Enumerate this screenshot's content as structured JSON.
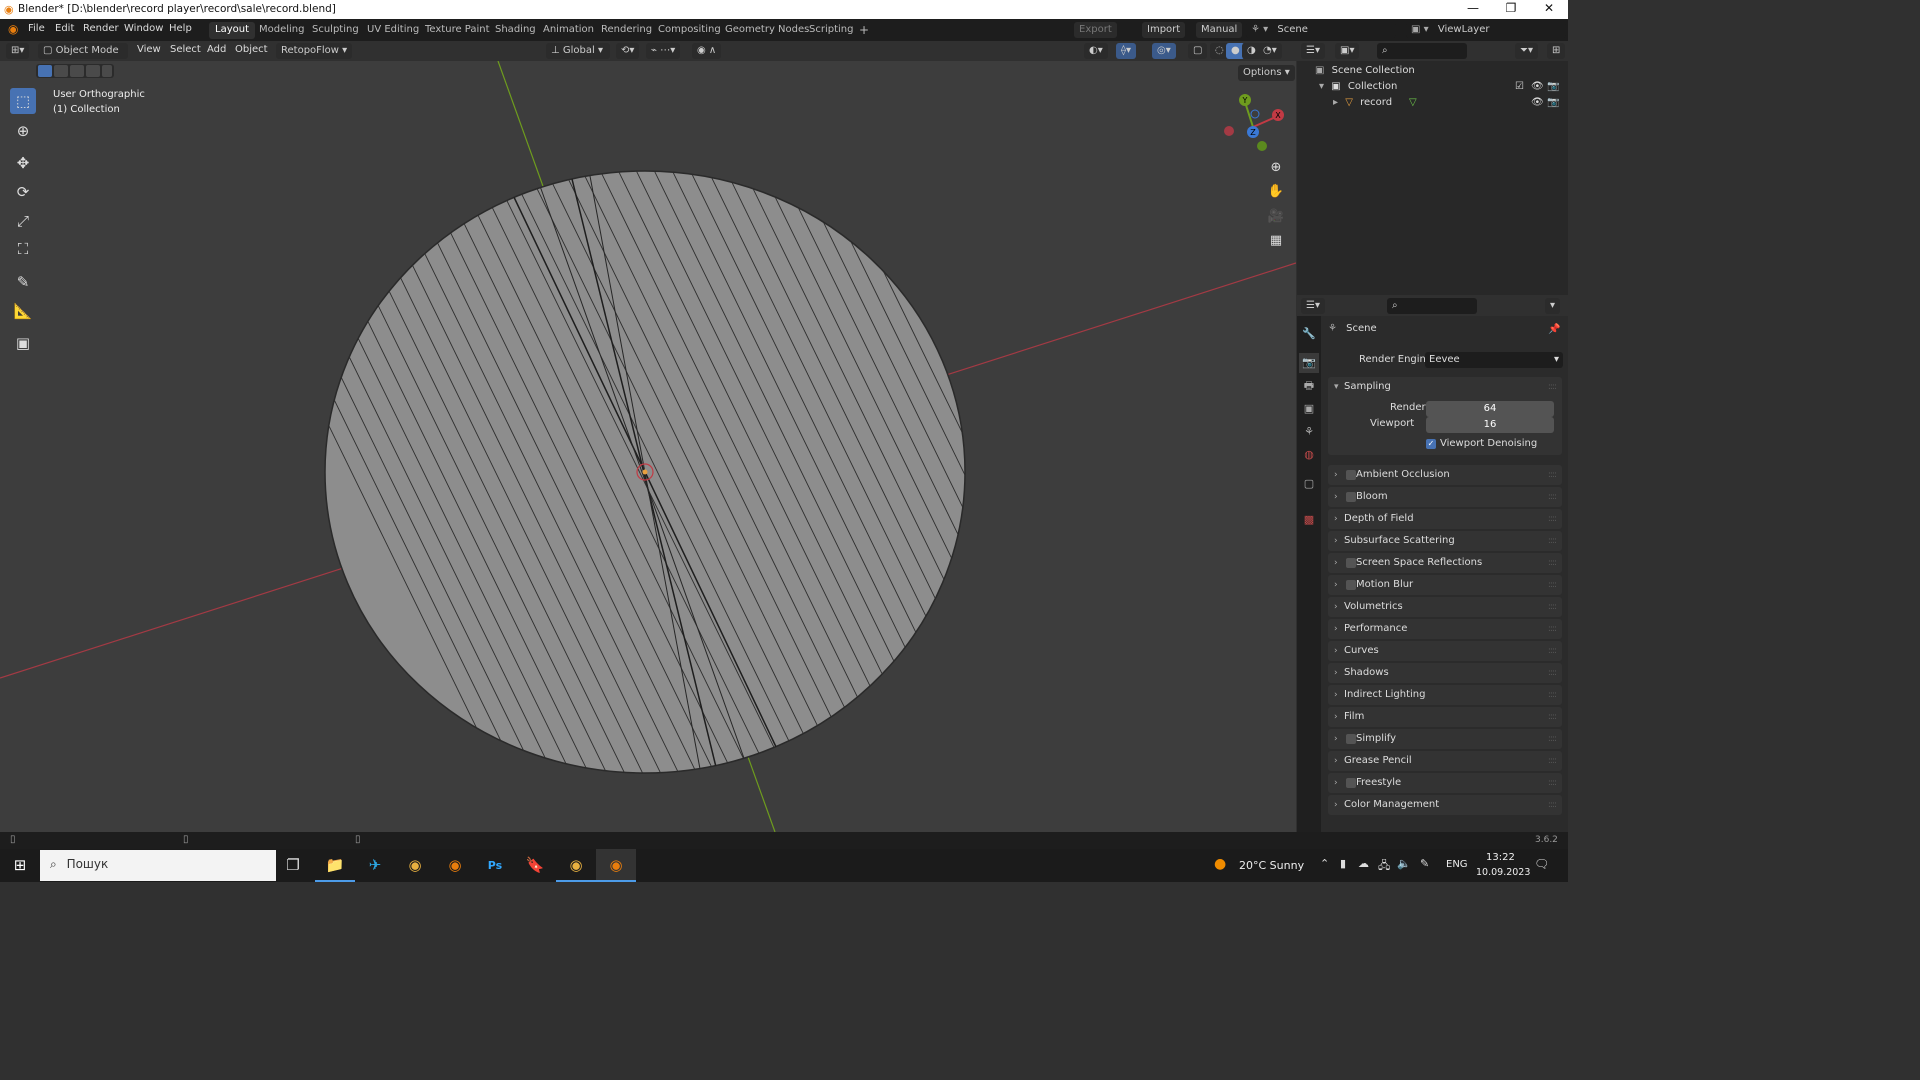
{
  "window": {
    "title": "Blender* [D:\\blender\\record player\\record\\sale\\record.blend]"
  },
  "menu": {
    "file": "File",
    "edit": "Edit",
    "render": "Render",
    "window": "Window",
    "help": "Help"
  },
  "workspaces": [
    "Layout",
    "Modeling",
    "Sculpting",
    "UV Editing",
    "Texture Paint",
    "Shading",
    "Animation",
    "Rendering",
    "Compositing",
    "Geometry Nodes",
    "Scripting"
  ],
  "add_workspace": "+",
  "top_right": {
    "export": "Export",
    "import": "Import",
    "manual": "Manual",
    "scene": "Scene",
    "view_layer": "ViewLayer"
  },
  "viewport_header": {
    "mode": "Object Mode",
    "view": "View",
    "select": "Select",
    "add": "Add",
    "object": "Object",
    "addon": "RetopoFlow",
    "transform_orientation": "Global",
    "options": "Options"
  },
  "viewport": {
    "view_name": "User Orthographic",
    "collection": "(1) Collection"
  },
  "gizmo": {
    "x": "X",
    "y": "Y",
    "z": "Z"
  },
  "outliner": {
    "scene_collection": "Scene Collection",
    "collection": "Collection",
    "object": "record"
  },
  "properties": {
    "scene_label": "Scene",
    "render_engine_label": "Render Engine",
    "render_engine_value": "Eevee",
    "sampling": {
      "title": "Sampling",
      "render_label": "Render",
      "render_value": "64",
      "viewport_label": "Viewport",
      "viewport_value": "16",
      "denoise_label": "Viewport Denoising"
    },
    "panels": [
      {
        "label": "Ambient Occlusion",
        "checkbox": true
      },
      {
        "label": "Bloom",
        "checkbox": true
      },
      {
        "label": "Depth of Field",
        "checkbox": false
      },
      {
        "label": "Subsurface Scattering",
        "checkbox": false
      },
      {
        "label": "Screen Space Reflections",
        "checkbox": true
      },
      {
        "label": "Motion Blur",
        "checkbox": true
      },
      {
        "label": "Volumetrics",
        "checkbox": false
      },
      {
        "label": "Performance",
        "checkbox": false
      },
      {
        "label": "Curves",
        "checkbox": false
      },
      {
        "label": "Shadows",
        "checkbox": false
      },
      {
        "label": "Indirect Lighting",
        "checkbox": false
      },
      {
        "label": "Film",
        "checkbox": false
      },
      {
        "label": "Simplify",
        "checkbox": true
      },
      {
        "label": "Grease Pencil",
        "checkbox": false
      },
      {
        "label": "Freestyle",
        "checkbox": true
      },
      {
        "label": "Color Management",
        "checkbox": false
      }
    ]
  },
  "status": {
    "version": "3.6.2"
  },
  "taskbar": {
    "search_placeholder": "Пошук",
    "weather": "20°C  Sunny",
    "lang": "ENG",
    "time": "13:22",
    "date": "10.09.2023"
  },
  "colors": {
    "accent": "#4772b3",
    "x_axis": "#c23a44",
    "y_axis": "#6e9c1e",
    "z_axis": "#3a79d6",
    "mesh": "#8d8d8d",
    "viewport_bg": "#3d3d3d"
  }
}
